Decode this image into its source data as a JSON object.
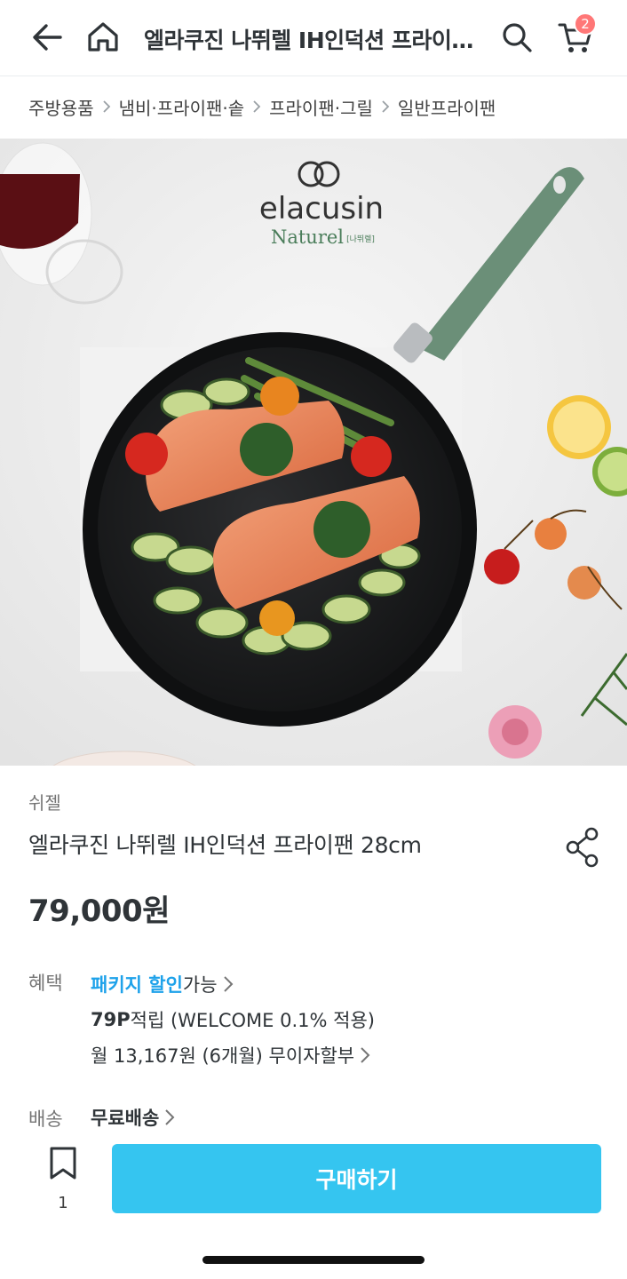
{
  "header": {
    "title": "엘라쿠진 나뛰렐 IH인덕션 프라이…",
    "cart_count": "2"
  },
  "breadcrumb": [
    "주방용품",
    "냄비·프라이팬·솥",
    "프라이팬·그릴",
    "일반프라이팬"
  ],
  "hero": {
    "logo_text": "elacusin",
    "logo_sub": "Naturel",
    "logo_sub_small": "[나뛰렐]"
  },
  "product": {
    "brand": "쉬젤",
    "name": "엘라쿠진 나뛰렐 IH인덕션 프라이팬 28cm",
    "price": "79,000원"
  },
  "benefit": {
    "label": "혜택",
    "package_highlight": "패키지 할인",
    "package_suffix": " 가능",
    "points_bold": "79P",
    "points_rest": " 적립 (WELCOME 0.1% 적용)",
    "installment": "월 13,167원 (6개월) 무이자할부"
  },
  "shipping": {
    "label": "배송",
    "value": "무료배송"
  },
  "bottom": {
    "bookmark_count": "1",
    "buy_label": "구매하기"
  },
  "colors": {
    "accent": "#35c5f0",
    "highlight": "#1ea2ea",
    "badge": "#ff7777"
  }
}
